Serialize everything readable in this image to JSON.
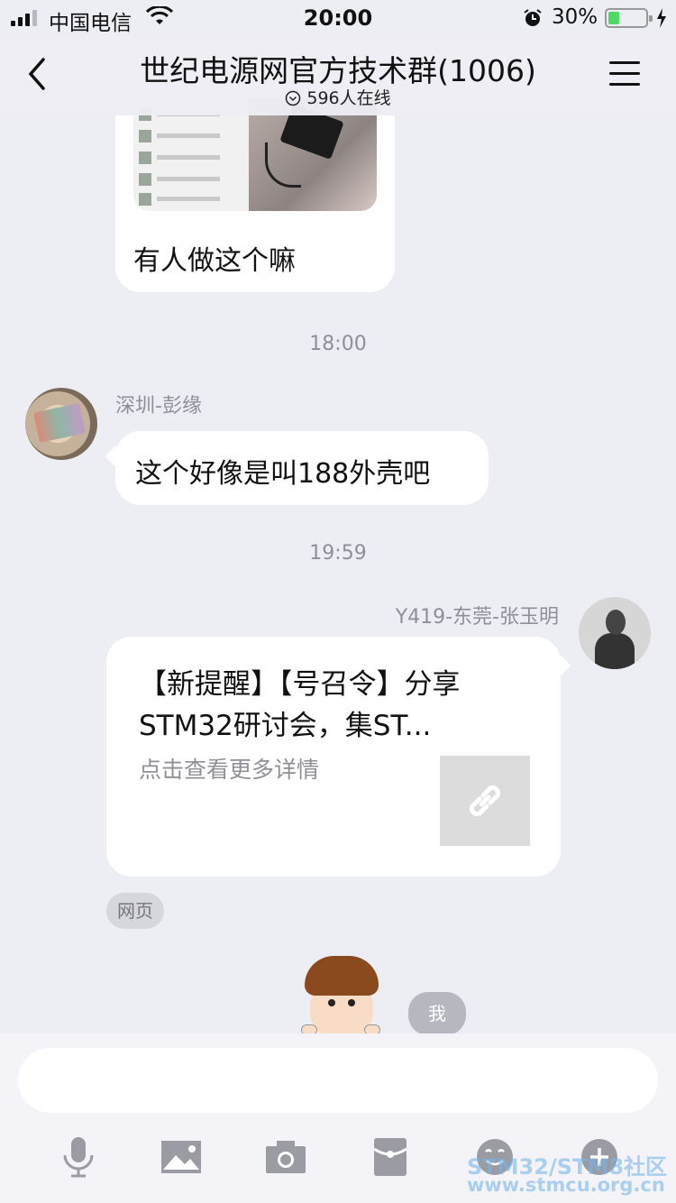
{
  "status_bar": {
    "carrier": "中国电信",
    "time": "20:00",
    "battery_percent": "30%",
    "battery_level": 0.3
  },
  "header": {
    "title": "世纪电源网官方技术群(1006)",
    "online": "596人在线"
  },
  "messages": {
    "image_caption": "有人做这个嘛",
    "time1": "18:00",
    "sender1": "深圳-彭缘",
    "text1": "这个好像是叫188外壳吧",
    "time2": "19:59",
    "sender2": "Y419-东莞-张玉明",
    "link_title": "【新提醒】【号召令】分享STM32研讨会，集ST...",
    "link_desc": "点击查看更多详情",
    "link_tag": "网页",
    "me_badge": "我"
  },
  "input": {
    "placeholder": ""
  },
  "toolbar": [
    "microphone-icon",
    "image-icon",
    "camera-icon",
    "red-packet-icon",
    "emoji-icon",
    "plus-icon"
  ],
  "watermark": {
    "line1": "STM32/STM8社区",
    "line2": "www.stmcu.org.cn"
  },
  "colors": {
    "background": "#ededf4",
    "bubble": "#ffffff",
    "muted_text": "#8f8f98",
    "battery_fill": "#4cd964"
  }
}
